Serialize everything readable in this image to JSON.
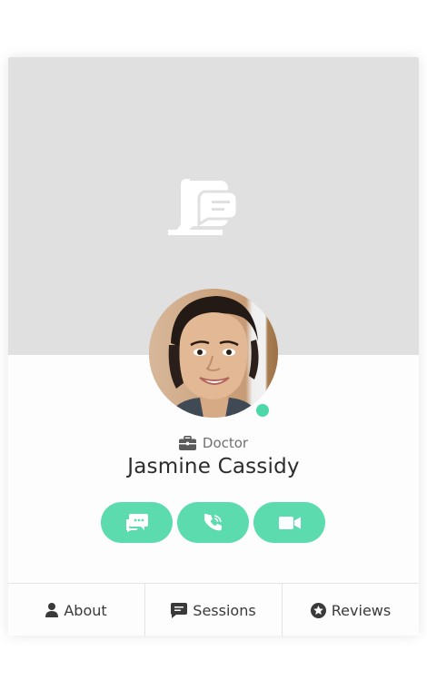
{
  "profile": {
    "role": "Doctor",
    "name": "Jasmine Cassidy",
    "status": "online"
  },
  "colors": {
    "accent": "#5cdcae",
    "status_online": "#4cd8a8",
    "cover_background": "#e0e0e0"
  },
  "actions": [
    {
      "icon": "chat-icon"
    },
    {
      "icon": "phone-icon"
    },
    {
      "icon": "video-icon"
    }
  ],
  "tabs": {
    "about": {
      "label": "About",
      "icon": "user-icon"
    },
    "sessions": {
      "label": "Sessions",
      "icon": "message-icon"
    },
    "reviews": {
      "label": "Reviews",
      "icon": "star-icon"
    }
  }
}
